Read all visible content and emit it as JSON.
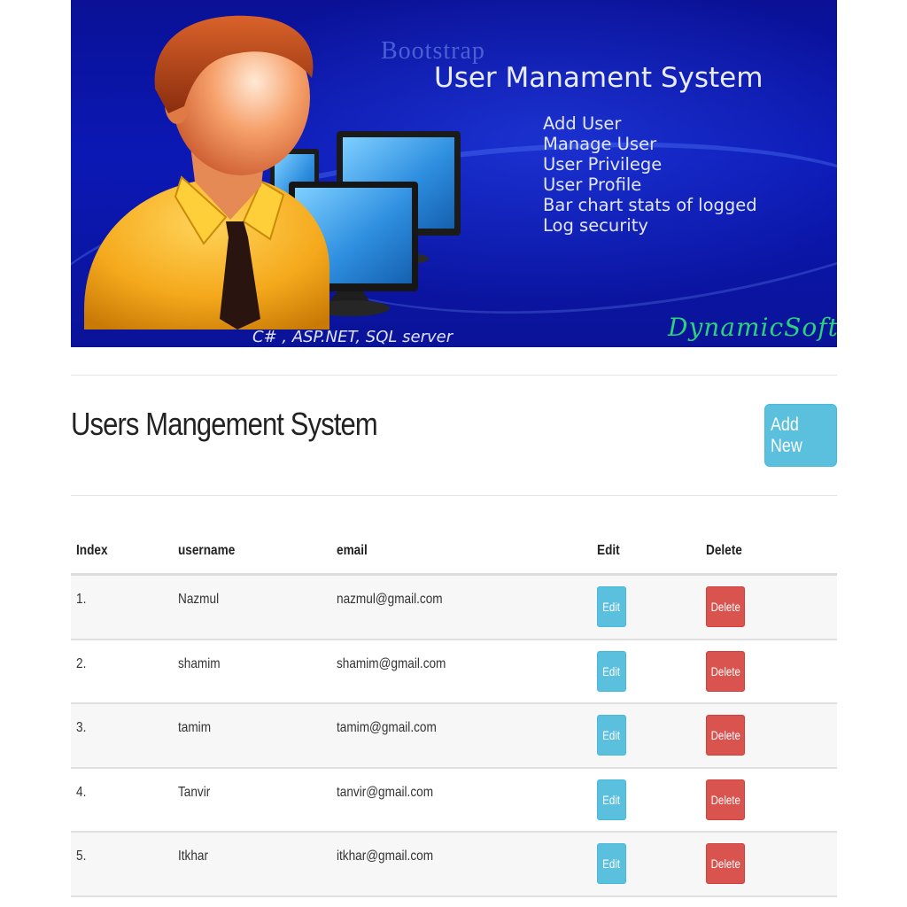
{
  "banner": {
    "kicker": "Bootstrap",
    "title": "User Manament System",
    "features": [
      "Add User",
      "Manage User",
      "User Privilege",
      "User Profile",
      "Bar chart stats of logged",
      "Log security"
    ],
    "tech": "C# , ASP.NET, SQL server",
    "brand": "DynamicSoft",
    "colors": {
      "background": "#0b18b4",
      "brand": "#2bd37a"
    }
  },
  "header": {
    "title": "Users Mangement System",
    "add_new_label": "Add New"
  },
  "table": {
    "columns": [
      "Index",
      "username",
      "email",
      "Edit",
      "Delete"
    ],
    "rows": [
      {
        "index": "1.",
        "username": "Nazmul",
        "email": "nazmul@gmail.com",
        "edit": "Edit",
        "delete": "Delete"
      },
      {
        "index": "2.",
        "username": "shamim",
        "email": "shamim@gmail.com",
        "edit": "Edit",
        "delete": "Delete"
      },
      {
        "index": "3.",
        "username": "tamim",
        "email": "tamim@gmail.com",
        "edit": "Edit",
        "delete": "Delete"
      },
      {
        "index": "4.",
        "username": "Tanvir",
        "email": "tanvir@gmail.com",
        "edit": "Edit",
        "delete": "Delete"
      },
      {
        "index": "5.",
        "username": "Itkhar",
        "email": "itkhar@gmail.com",
        "edit": "Edit",
        "delete": "Delete"
      }
    ]
  },
  "colors": {
    "info": "#5bc0de",
    "danger": "#d9534f"
  }
}
